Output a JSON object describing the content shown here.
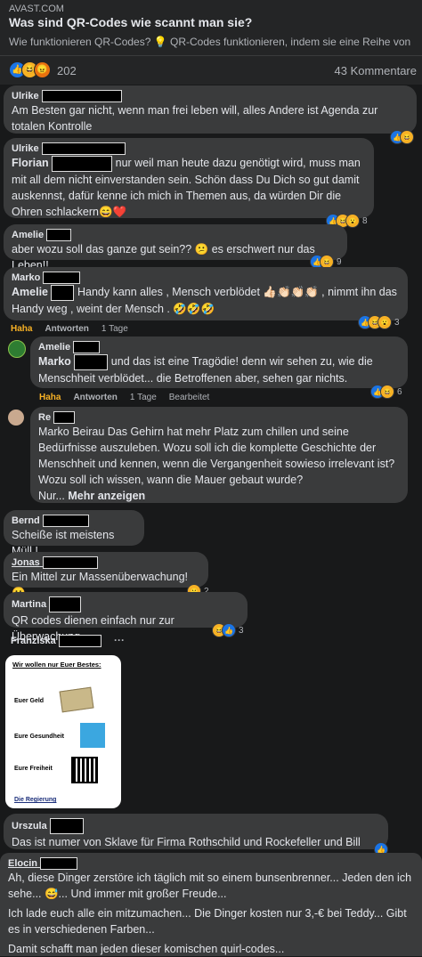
{
  "post": {
    "source": "AVAST.COM",
    "title": "Was sind QR-Codes wie scannt man sie?",
    "subtitle": "Wie funktionieren QR-Codes? 💡 QR-Codes funktionieren, indem sie eine Reihe von",
    "reaction_count": "202",
    "comments_count": "43 Kommentare"
  },
  "comments": [
    {
      "name": "Ulrike",
      "text": "Am Besten gar nicht, wenn man frei leben will, alles Andere ist Agenda zur totalen Kontrolle"
    },
    {
      "name": "Ulrike",
      "tag": "Florian",
      "text": "nur weil man heute dazu genötigt wird, muss man mit all dem nicht einverstanden sein. Schön dass Du Dich so gut damit auskennst, dafür kenne ich mich in Themen aus, da würden Dir die Ohren schlackern😄❤️",
      "reactions": "8"
    },
    {
      "name": "Amelie",
      "text": "aber wozu soll das ganze gut sein?? 😕 es erschwert nur das Leben!!",
      "reactions": "9"
    },
    {
      "name": "Marko",
      "tag": "Amelie",
      "text": "Handy kann alles , Mensch verblödet 👍🏻👏🏻👏🏻👏🏻 , nimmt ihn das Handy weg , weint der Mensch . 🤣🤣🤣",
      "reactions": "3"
    },
    {
      "name": "Amelie",
      "tag": "Marko",
      "text": "und das ist eine Tragödie! denn wir sehen zu, wie die Menschheit verblödet... die Betroffenen aber, sehen gar nichts.",
      "reactions": "6"
    },
    {
      "name": "Re",
      "text": "Marko Beirau Das Gehirn hat mehr Platz zum chillen und seine Bedürfnisse auszuleben. Wozu soll ich die komplette Geschichte der Menschheit und kennen, wenn die Vergangenheit sowieso irrelevant ist? Wozu soll ich wissen, wann die Mauer gebaut wurde?",
      "more_prefix": "Nur...",
      "more": "Mehr anzeigen"
    },
    {
      "name": "Bernd",
      "text": "Scheiße ist meistens Müll !"
    },
    {
      "name": "Jonas",
      "text": "Ein Mittel zur Massenüberwachung! 😮",
      "reactions": "2"
    },
    {
      "name": "Martina",
      "text": "QR codes dienen einfach nur zur Überwachung.",
      "reactions": "3"
    },
    {
      "name": "Franziska",
      "dots": "···"
    },
    {
      "name": "Urszula",
      "text": "Das ist numer von Sklave für Firma Rothschild und Rockefeller und Bill Gates"
    },
    {
      "name": "Elocin",
      "p1": "Ah, diese Dinger zerstöre ich täglich mit so einem bunsenbrenner... Jeden den ich sehe... 😅... Und immer mit großer Freude...",
      "p2": "Ich lade euch alle ein mitzumachen... Die Dinger kosten nur 3,-€ bei Teddy... Gibt es in verschiedenen Farben...",
      "p3": "Damit schafft man jeden dieser komischen quirl-codes..."
    }
  ],
  "actions": {
    "haha": "Haha",
    "reply": "Antworten",
    "time": "1 Tage",
    "edited": "Bearbeitet"
  },
  "meme": {
    "heading": "Wir wollen nur Euer Bestes:",
    "row1": "Euer Geld",
    "row2": "Eure Gesundheit",
    "row3": "Eure Freiheit",
    "footer": "Die Regierung"
  },
  "colors": {
    "bg": "#18191a",
    "bubble": "#3a3b3c",
    "like": "#1b74e4",
    "haha": "#f7b125"
  }
}
